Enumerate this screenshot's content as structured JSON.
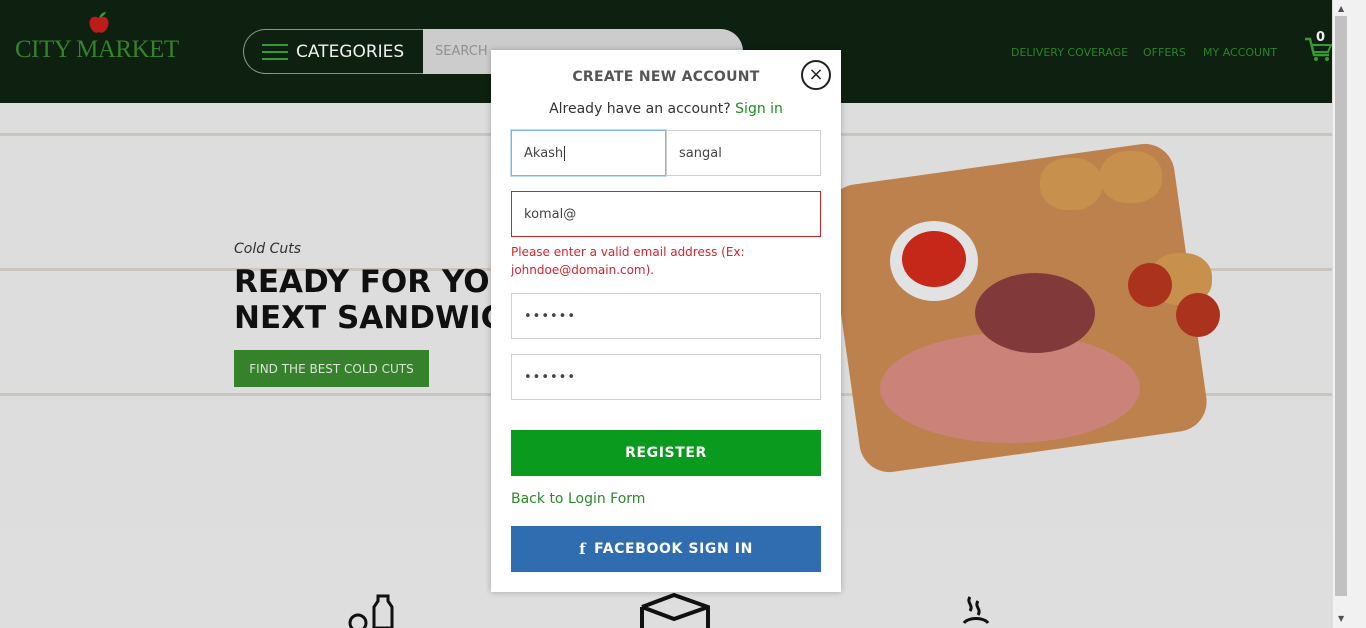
{
  "header": {
    "logo_text": "CITY MARKET",
    "categories_label": "CATEGORIES",
    "search_placeholder": "SEARCH",
    "nav": [
      "DELIVERY COVERAGE",
      "OFFERS",
      "MY ACCOUNT"
    ],
    "cart_count": "0",
    "colors": {
      "background": "#0f2312",
      "accent": "#3a8a2e"
    }
  },
  "hero": {
    "subtitle": "Cold Cuts",
    "title_line1": "READY FOR YOUR",
    "title_line2": "NEXT SANDWICH",
    "cta_label": "FIND THE BEST COLD CUTS"
  },
  "modal": {
    "title": "CREATE NEW ACCOUNT",
    "already_text": "Already have an account?",
    "sign_in_link": "Sign in",
    "first_name_value": "Akash",
    "last_name_value": "sangal",
    "email_value": "komal@",
    "email_error": "Please enter a valid email address (Ex: johndoe@domain.com).",
    "password_value": "••••••",
    "confirm_password_value": "••••••",
    "register_label": "REGISTER",
    "back_link": "Back to Login Form",
    "facebook_label": "FACEBOOK SIGN IN",
    "close_symbol": "×",
    "colors": {
      "register": "#0a9a1e",
      "facebook": "#2f6db0",
      "error": "#d4252d"
    }
  }
}
